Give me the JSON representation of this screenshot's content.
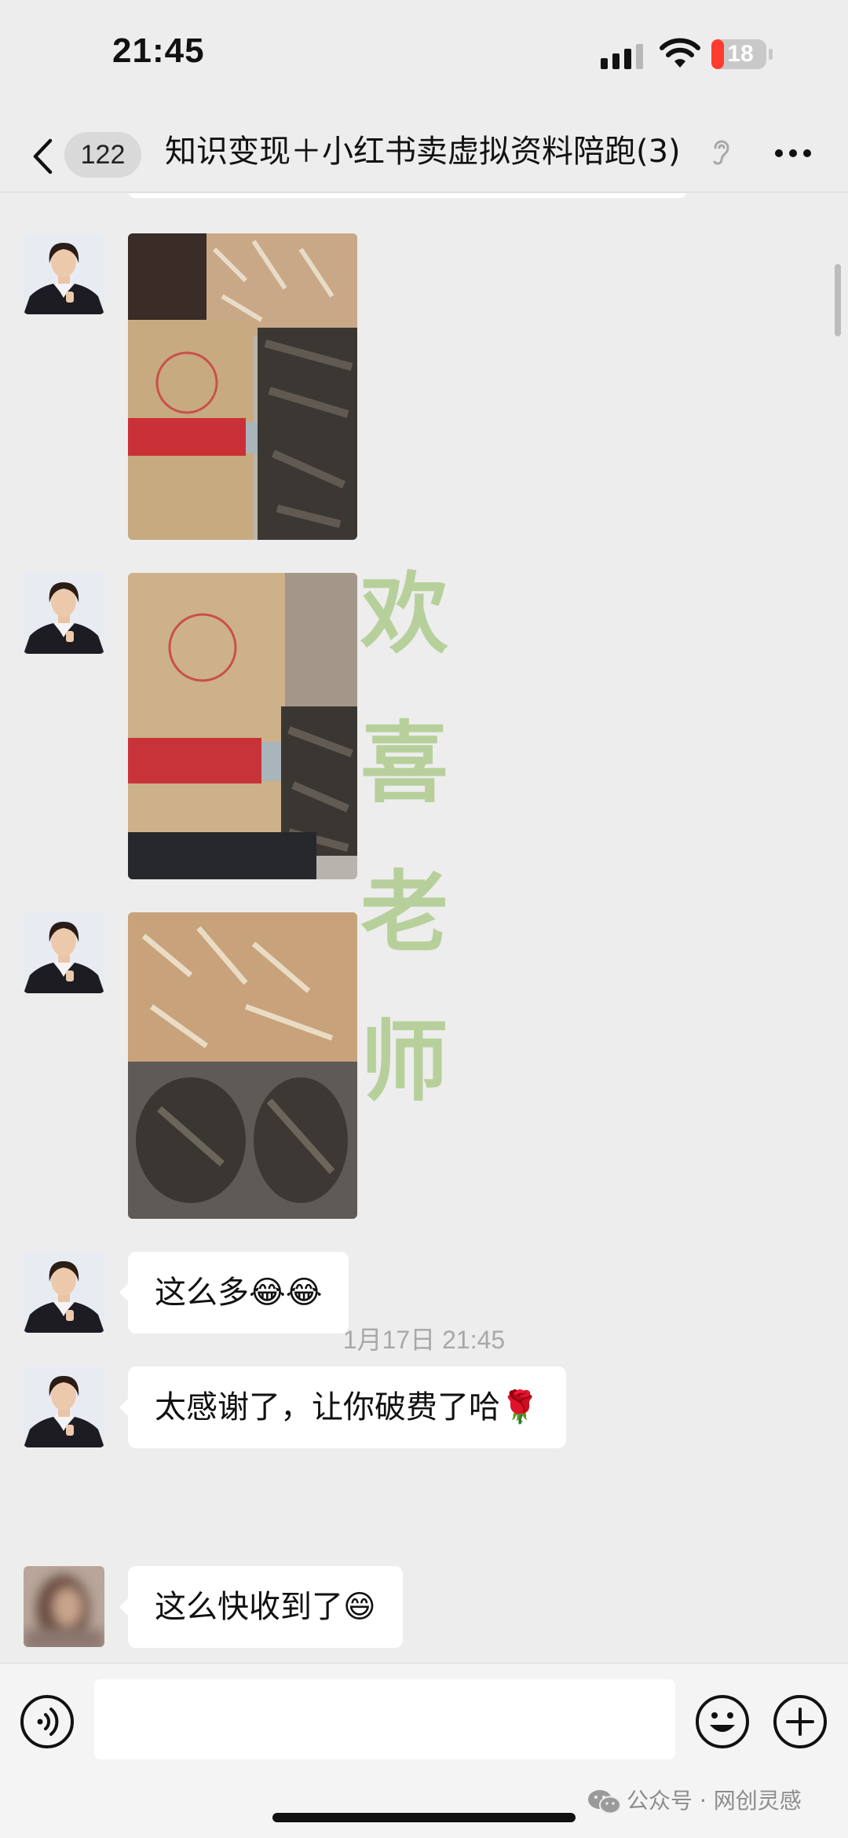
{
  "status_bar": {
    "time": "21:45",
    "battery": "18",
    "signal_icon": "cellular-signal-icon",
    "wifi_icon": "wifi-icon",
    "battery_color": "#ff3b30"
  },
  "header": {
    "unread_count": "122",
    "title": "知识变现＋小红书卖虚拟资料陪跑(3)",
    "back_icon": "chevron-left-icon",
    "mute_icon": "mute-ear-icon",
    "more_icon": "more-dots-icon"
  },
  "messages": [
    {
      "type": "image",
      "content": "photo of gift food packages"
    },
    {
      "type": "image",
      "content": "photo of gift food packages"
    },
    {
      "type": "image",
      "content": "photo of gift food packages"
    },
    {
      "type": "text",
      "text": "这么多😂😂"
    },
    {
      "type": "text",
      "text": "太感谢了，让你破费了哈🌹"
    },
    {
      "type": "timestamp",
      "text": "1月17日 21:45"
    },
    {
      "type": "text",
      "text": "这么快收到了😄"
    }
  ],
  "watermark": [
    "欢",
    "喜",
    "老",
    "师"
  ],
  "input_bar": {
    "input_value": "",
    "voice_icon": "voice-input-icon",
    "emoji_icon": "emoji-icon",
    "plus_icon": "plus-icon"
  },
  "source": "公众号 · 网创灵感",
  "colors": {
    "background": "#ededed",
    "bubble": "#ffffff",
    "badge": "#d9d9d9",
    "watermark": "#96be69"
  }
}
